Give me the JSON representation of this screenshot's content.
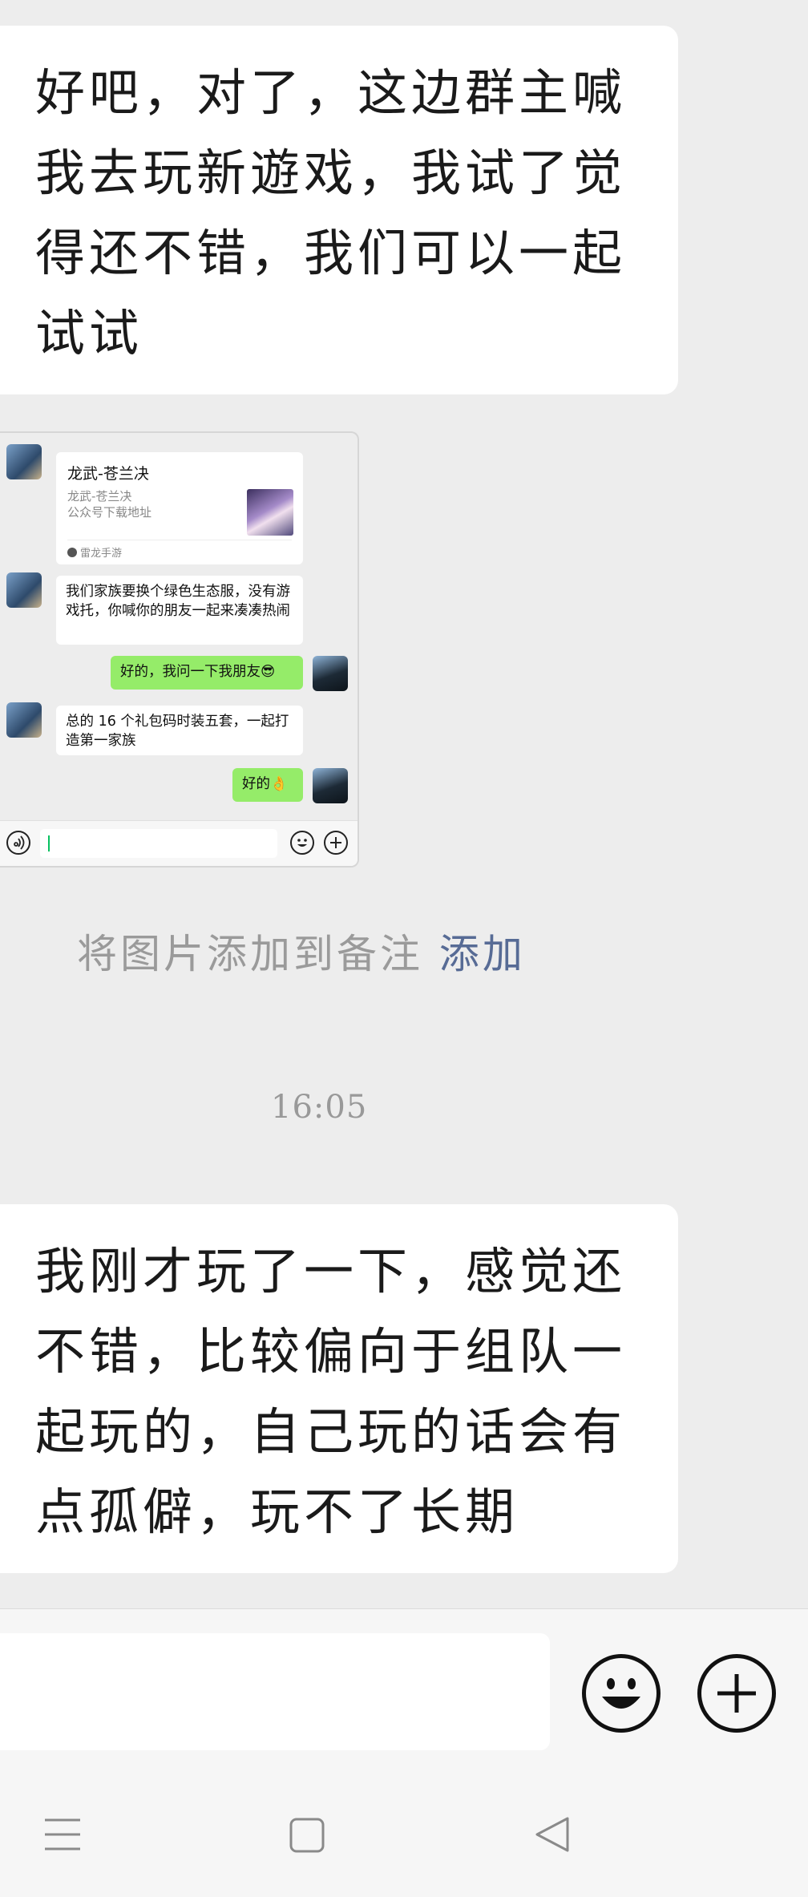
{
  "messages": [
    {
      "text": "好吧，对了，这边群主喊我去玩新遊戏，我试了觉得还不错，我们可以一起试试"
    },
    {
      "text": "我刚才玩了一下，感觉还不错，比较偏向于组队一起玩的，自己玩的话会有点孤僻，玩不了长期"
    }
  ],
  "shared_screenshot": {
    "card": {
      "title": "龙武-苍兰决",
      "subtitle": "龙武-苍兰决",
      "desc": "公众号下载地址",
      "source": "雷龙手游"
    },
    "chat": [
      {
        "text": "我们家族要换个绿色生态服，没有游戏托，你喊你的朋友一起来凑凑热闹"
      },
      {
        "text": "好的，我问一下我朋友😎"
      },
      {
        "text": "总的 16 个礼包码时装五套，一起打造第一家族"
      },
      {
        "text": "好的👌"
      }
    ]
  },
  "add_note": {
    "text": "将图片添加到备注",
    "link": "添加"
  },
  "timestamp": "16:05",
  "compose": {
    "value": ""
  },
  "colors": {
    "accent": "#95ec69",
    "link": "#576b95",
    "background": "#ededed"
  }
}
